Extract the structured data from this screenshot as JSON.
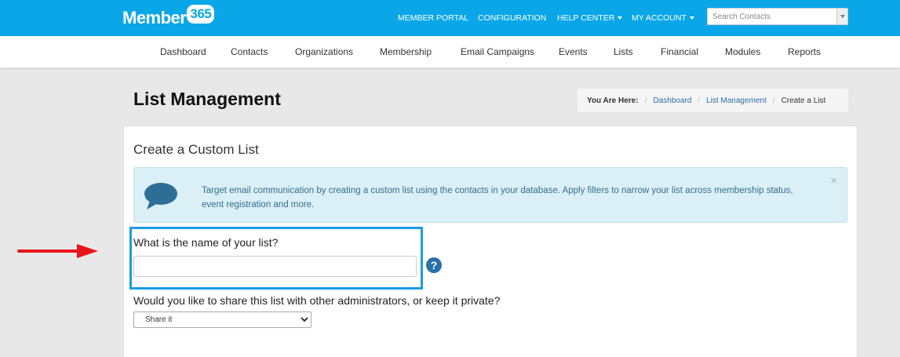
{
  "brand": {
    "name": "Member",
    "badge": "365"
  },
  "topnav": {
    "member_portal": "MEMBER PORTAL",
    "configuration": "CONFIGURATION",
    "help_center": "HELP CENTER",
    "my_account": "MY ACCOUNT"
  },
  "search": {
    "placeholder": "Search Contacts"
  },
  "mainnav": [
    "Dashboard",
    "Contacts",
    "Organizations",
    "Membership",
    "Email Campaigns",
    "Events",
    "Lists",
    "Financial",
    "Modules",
    "Reports"
  ],
  "page": {
    "title": "List Management"
  },
  "breadcrumb": {
    "lead": "You Are Here:",
    "items": [
      "Dashboard",
      "List Management"
    ],
    "current": "Create a List"
  },
  "panel": {
    "title": "Create a Custom List"
  },
  "alert": {
    "text": "Target email communication by creating a custom list using the contacts in your database. Apply filters to narrow your list across membership status, event registration and more.",
    "close": "×"
  },
  "form": {
    "name_label": "What is the name of your list?",
    "name_value": "",
    "help": "?",
    "share_label": "Would you like to share this list with other administrators, or keep it private?",
    "share_selected": "Share it"
  },
  "colors": {
    "brand_blue": "#0aa7e8",
    "highlight": "#1a9ce8",
    "arrow": "#e8151b",
    "alert_bg": "#dbeff7"
  },
  "icons": [
    "speech-bubble-icon",
    "question-circle-icon",
    "close-icon",
    "red-arrow-annotation"
  ]
}
